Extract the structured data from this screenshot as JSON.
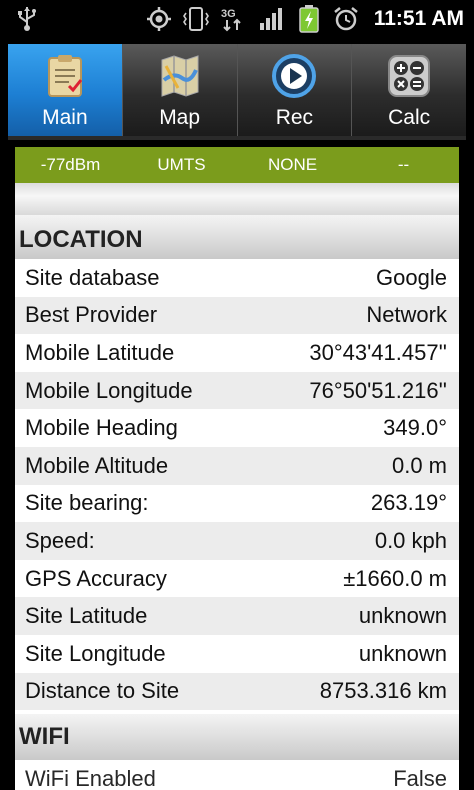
{
  "statusbar": {
    "time": "11:51 AM",
    "icons": [
      "usb-icon",
      "gps-icon",
      "vibrate-icon",
      "3g-icon",
      "signal-icon",
      "battery-charging-icon",
      "alarm-icon"
    ],
    "network_type": "3G"
  },
  "tabs": [
    {
      "label": "Main",
      "icon": "clipboard-icon",
      "active": true
    },
    {
      "label": "Map",
      "icon": "map-icon",
      "active": false
    },
    {
      "label": "Rec",
      "icon": "record-icon",
      "active": false
    },
    {
      "label": "Calc",
      "icon": "calculator-icon",
      "active": false
    }
  ],
  "signal": {
    "strength": "-77dBm",
    "network": "UMTS",
    "status": "NONE",
    "extra": "--"
  },
  "location": {
    "header": "LOCATION",
    "rows": [
      {
        "label": "Site database",
        "value": "Google"
      },
      {
        "label": "Best Provider",
        "value": "Network"
      },
      {
        "label": "Mobile Latitude",
        "value": "30°43'41.457''"
      },
      {
        "label": "Mobile Longitude",
        "value": "76°50'51.216''"
      },
      {
        "label": "Mobile Heading",
        "value": "349.0°"
      },
      {
        "label": "Mobile Altitude",
        "value": "0.0 m"
      },
      {
        "label": "Site bearing:",
        "value": "263.19°"
      },
      {
        "label": "Speed:",
        "value": "0.0 kph"
      },
      {
        "label": "GPS Accuracy",
        "value": "±1660.0 m"
      },
      {
        "label": "Site Latitude",
        "value": "unknown"
      },
      {
        "label": "Site Longitude",
        "value": "unknown"
      },
      {
        "label": "Distance to Site",
        "value": "8753.316 km"
      }
    ]
  },
  "wifi": {
    "header": "WIFI",
    "rows": [
      {
        "label": "WiFi Enabled",
        "value": "False"
      }
    ]
  },
  "colors": {
    "accent_tab": "#1d7fd3",
    "signal_bar": "#7b9c1c",
    "battery_charging": "#7ec832"
  }
}
